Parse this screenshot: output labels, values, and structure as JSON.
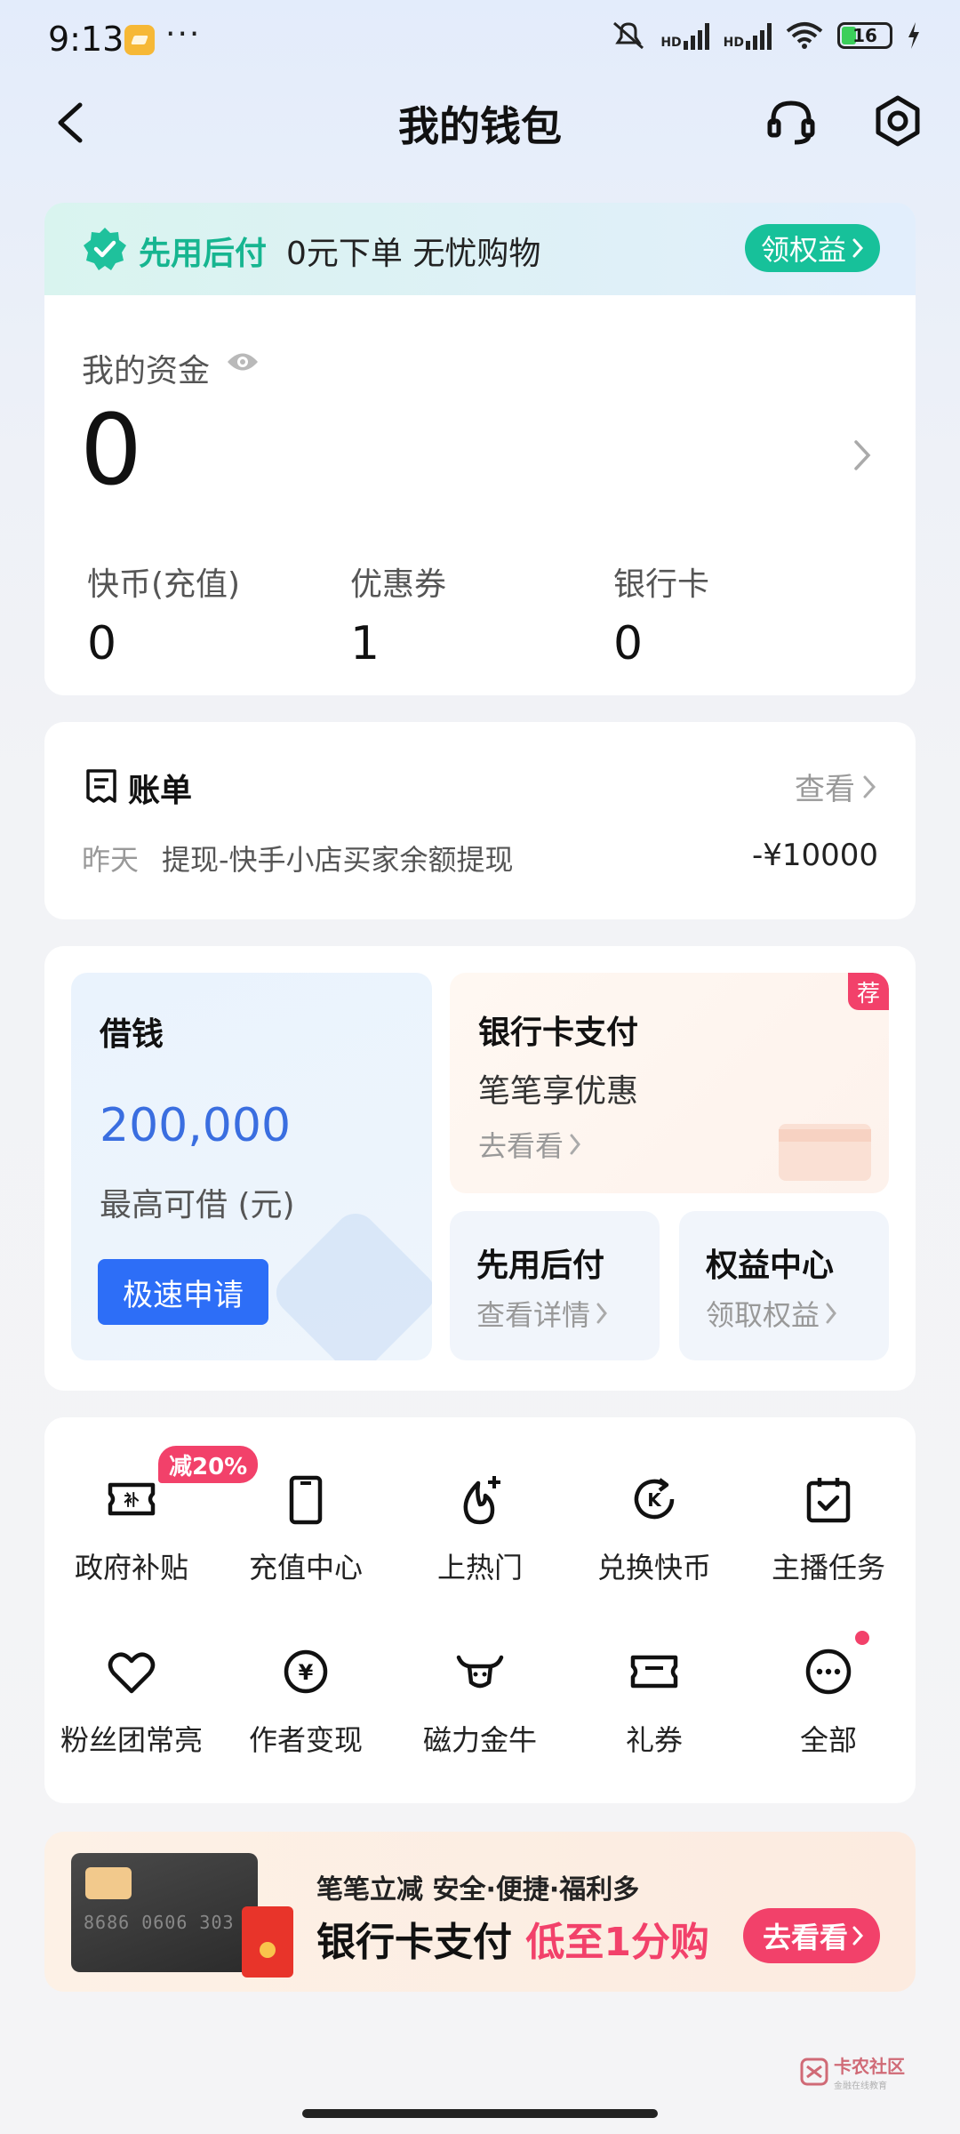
{
  "status_bar": {
    "time": "9:13",
    "dots": "···",
    "hd1": "HD",
    "hd2": "HD",
    "battery": "16"
  },
  "header": {
    "title": "我的钱包"
  },
  "pay_later_banner": {
    "title": "先用后付",
    "description": "0元下单 无忧购物",
    "cta": "领权益"
  },
  "funds": {
    "label": "我的资金",
    "amount": "0",
    "stats": [
      {
        "label": "快币(充值)",
        "value": "0"
      },
      {
        "label": "优惠券",
        "value": "1"
      },
      {
        "label": "银行卡",
        "value": "0"
      }
    ]
  },
  "bill": {
    "title": "账单",
    "view_label": "查看",
    "date": "昨天",
    "description": "提现-快手小店买家余额提现",
    "amount": "-¥10000"
  },
  "finance": {
    "loan": {
      "title": "借钱",
      "amount": "200,000",
      "subtitle": "最高可借 (元)",
      "button": "极速申请"
    },
    "bank_pay": {
      "title": "银行卡支付",
      "subtitle": "笔笔享优惠",
      "link": "去看看",
      "badge": "荐"
    },
    "pay_later": {
      "title": "先用后付",
      "link": "查看详情"
    },
    "benefits": {
      "title": "权益中心",
      "link": "领取权益"
    }
  },
  "services": {
    "discount_badge": "减20%",
    "items": [
      {
        "label": "政府补贴",
        "icon": "subsidy-ticket-icon"
      },
      {
        "label": "充值中心",
        "icon": "phone-icon"
      },
      {
        "label": "上热门",
        "icon": "flame-plus-icon"
      },
      {
        "label": "兑换快币",
        "icon": "coin-exchange-icon"
      },
      {
        "label": "主播任务",
        "icon": "calendar-check-icon"
      },
      {
        "label": "粉丝团常亮",
        "icon": "heart-icon"
      },
      {
        "label": "作者变现",
        "icon": "yuan-circle-icon"
      },
      {
        "label": "磁力金牛",
        "icon": "bull-icon"
      },
      {
        "label": "礼券",
        "icon": "coupon-icon"
      },
      {
        "label": "全部",
        "icon": "more-dots-icon"
      }
    ]
  },
  "promo": {
    "card_number": "8686 0606 303",
    "line1": "笔笔立减 安全·便捷·福利多",
    "line2_main": "银行卡支付",
    "line2_highlight": "低至1分购",
    "button": "去看看"
  },
  "watermark": {
    "name": "卡农社区",
    "tagline": "金融在线教育"
  },
  "colors": {
    "accent_blue": "#2d6ef7",
    "accent_green": "#17c19a",
    "accent_red": "#f2416a"
  }
}
